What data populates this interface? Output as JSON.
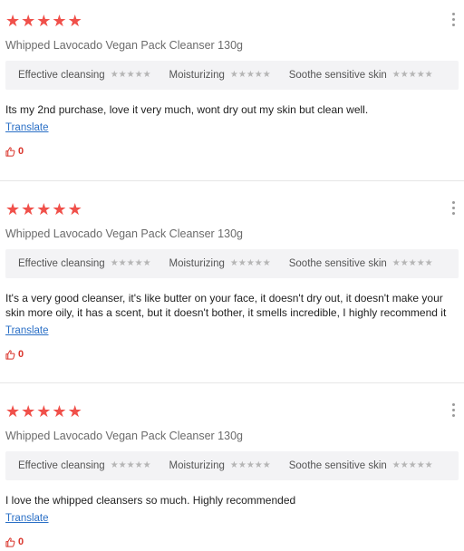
{
  "reviews": [
    {
      "rating": 5,
      "product": "Whipped Lavocado Vegan Pack Cleanser 130g",
      "attributes": [
        {
          "label": "Effective cleansing",
          "rating": 5
        },
        {
          "label": "Moisturizing",
          "rating": 5
        },
        {
          "label": "Soothe sensitive skin",
          "rating": 5
        }
      ],
      "text": "Its my 2nd purchase, love it very much, wont dry out my skin but clean well.",
      "translate_label": "Translate",
      "likes": "0"
    },
    {
      "rating": 5,
      "product": "Whipped Lavocado Vegan Pack Cleanser 130g",
      "attributes": [
        {
          "label": "Effective cleansing",
          "rating": 5
        },
        {
          "label": "Moisturizing",
          "rating": 5
        },
        {
          "label": "Soothe sensitive skin",
          "rating": 5
        }
      ],
      "text": "It's a very good cleanser, it's like butter on your face, it doesn't dry out, it doesn't make your skin more oily, it has a scent, but it doesn't bother, it smells incredible, I highly recommend it",
      "translate_label": "Translate",
      "likes": "0"
    },
    {
      "rating": 5,
      "product": "Whipped Lavocado Vegan Pack Cleanser 130g",
      "attributes": [
        {
          "label": "Effective cleansing",
          "rating": 5
        },
        {
          "label": "Moisturizing",
          "rating": 5
        },
        {
          "label": "Soothe sensitive skin",
          "rating": 5
        }
      ],
      "text": "I love the whipped cleansers so much. Highly recommended",
      "translate_label": "Translate",
      "likes": "0"
    }
  ],
  "icons": {
    "star": "star-icon",
    "more": "more-vertical-icon",
    "like": "thumbs-up-icon"
  },
  "colors": {
    "star_main": "#f0504a",
    "star_attr": "#b5b5b5",
    "link": "#2a6fc6",
    "like_count": "#d9342b"
  }
}
